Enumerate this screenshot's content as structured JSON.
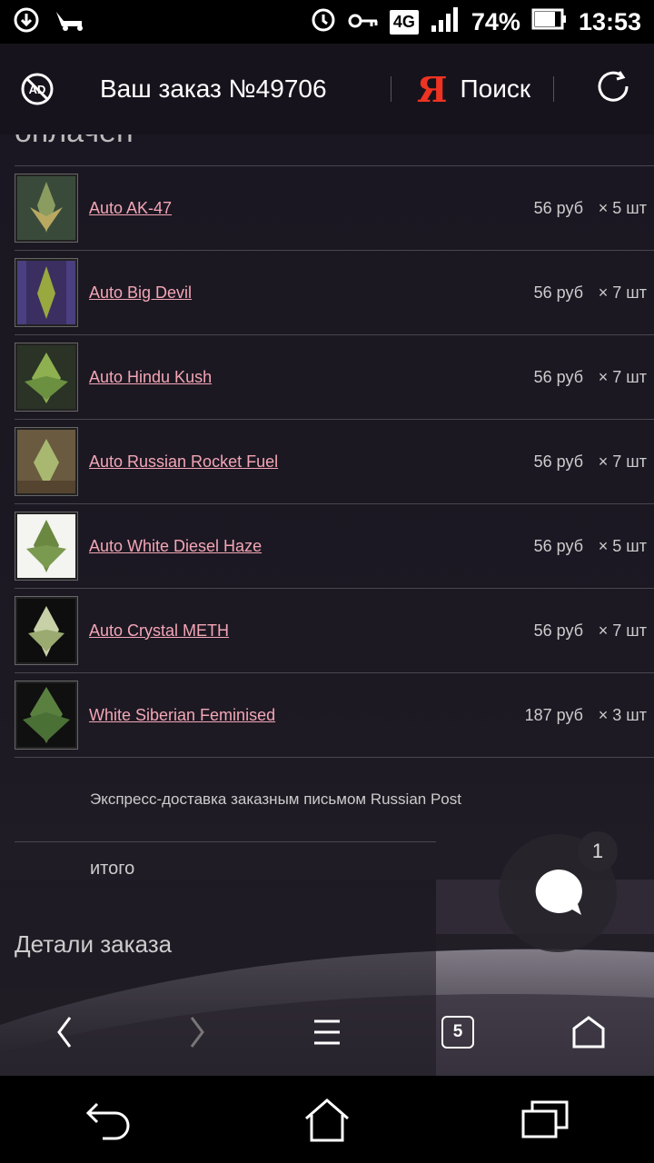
{
  "status_bar": {
    "network": "4G",
    "battery": "74%",
    "time": "13:53"
  },
  "header": {
    "order_title": "Ваш заказ №49706",
    "search_label": "Поиск",
    "ya_logo": "Я"
  },
  "content": {
    "paid_status": "оплачен",
    "items": [
      {
        "name": "Auto AK-47",
        "price": "56 руб",
        "qty": "× 5 шт"
      },
      {
        "name": "Auto Big Devil",
        "price": "56 руб",
        "qty": "× 7 шт"
      },
      {
        "name": "Auto Hindu Kush",
        "price": "56 руб",
        "qty": "× 7 шт"
      },
      {
        "name": "Auto Russian Rocket Fuel",
        "price": "56 руб",
        "qty": "× 7 шт"
      },
      {
        "name": "Auto White Diesel Haze",
        "price": "56 руб",
        "qty": "× 5 шт"
      },
      {
        "name": "Auto Crystal METH",
        "price": "56 руб",
        "qty": "× 7 шт"
      },
      {
        "name": "White Siberian Feminised",
        "price": "187 руб",
        "qty": "× 3 шт"
      }
    ],
    "delivery": "Экспресс-доставка заказным письмом Russian Post",
    "total_label": "итого",
    "details_title": "Детали заказа"
  },
  "chat": {
    "badge_count": "1"
  },
  "browser_toolbar": {
    "tabs_count": "5"
  },
  "colors": {
    "link": "#f3a6b5",
    "background": "#1b1722",
    "ya_logo": "#ee3322"
  }
}
